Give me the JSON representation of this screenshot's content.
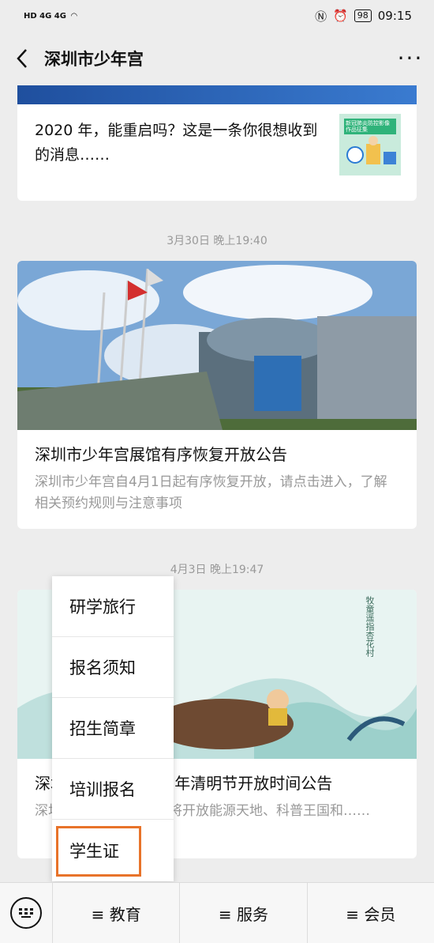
{
  "status": {
    "left": "HD 4G 4G",
    "battery": "98",
    "time": "09:15"
  },
  "header": {
    "title": "深圳市少年宫"
  },
  "articles": [
    {
      "title": "2020 年，能重启吗？这是一条你很想收到的消息……",
      "thumb_text": "新冠肺炎防控影像作品征集"
    },
    {
      "timestamp": "3月30日 晚上19:40",
      "title": "深圳市少年宫展馆有序恢复开放公告",
      "desc": "深圳市少年宫自4月1日起有序恢复开放，请点击进入，了解相关预约规则与注意事项"
    },
    {
      "timestamp": "4月3日 晚上19:47",
      "title": "深圳市少年宫2020 年清明节开放时间公告",
      "desc": "深圳市少年宫清明期间将开放能源天地、科普王国和……",
      "poem": "牧童遥指杏花村"
    }
  ],
  "menu": {
    "items": [
      "研学旅行",
      "报名须知",
      "招生简章",
      "培训报名",
      "学生证"
    ],
    "highlight_color": "#e8732a"
  },
  "bottom": {
    "tabs": [
      "≡ 教育",
      "≡ 服务",
      "≡ 会员"
    ]
  }
}
